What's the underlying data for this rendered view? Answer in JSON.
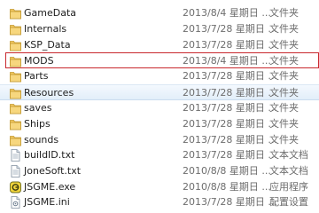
{
  "rows": [
    {
      "name": "GameData",
      "date": "2013/8/4 星期日 ...",
      "type": "文件夹",
      "icon": "folder-icon"
    },
    {
      "name": "Internals",
      "date": "2013/7/28 星期日 ...",
      "type": "文件夹",
      "icon": "folder-icon"
    },
    {
      "name": "KSP_Data",
      "date": "2013/7/28 星期日 ...",
      "type": "文件夹",
      "icon": "folder-icon"
    },
    {
      "name": "MODS",
      "date": "2013/8/4 星期日 ...",
      "type": "文件夹",
      "icon": "folder-icon"
    },
    {
      "name": "Parts",
      "date": "2013/7/28 星期日 ...",
      "type": "文件夹",
      "icon": "folder-icon"
    },
    {
      "name": "Resources",
      "date": "2013/7/28 星期日 ...",
      "type": "文件夹",
      "icon": "folder-icon"
    },
    {
      "name": "saves",
      "date": "2013/7/28 星期日 ...",
      "type": "文件夹",
      "icon": "folder-icon"
    },
    {
      "name": "Ships",
      "date": "2013/7/28 星期日 ...",
      "type": "文件夹",
      "icon": "folder-icon"
    },
    {
      "name": "sounds",
      "date": "2013/7/28 星期日 ...",
      "type": "文件夹",
      "icon": "folder-icon"
    },
    {
      "name": "buildID.txt",
      "date": "2013/7/28 星期日 ...",
      "type": "文本文档",
      "icon": "text-file-icon"
    },
    {
      "name": "JoneSoft.txt",
      "date": "2010/8/8 星期日 ...",
      "type": "文本文档",
      "icon": "text-file-icon"
    },
    {
      "name": "JSGME.exe",
      "date": "2010/8/8 星期日 ...",
      "type": "应用程序",
      "icon": "jsgme-app-icon"
    },
    {
      "name": "JSGME.ini",
      "date": "2013/7/28 星期日 ...",
      "type": "配置设置",
      "icon": "ini-file-icon"
    }
  ],
  "colors": {
    "outline": "#c8282e",
    "folder": "#f1c65d",
    "hover": "#e2eef9"
  }
}
